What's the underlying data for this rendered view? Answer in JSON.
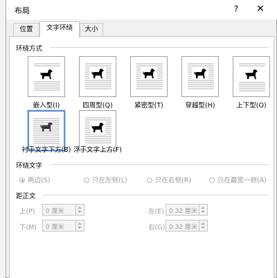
{
  "window": {
    "title": "布局",
    "help": "?",
    "close": "✕"
  },
  "tabs": [
    {
      "label": "位置",
      "active": false
    },
    {
      "label": "文字环绕",
      "active": true
    },
    {
      "label": "大小",
      "active": false
    }
  ],
  "wrap_style": {
    "heading": "环绕方式",
    "options": [
      {
        "label": "嵌入型(I)",
        "icon": "wrap-inline-icon",
        "selected": false
      },
      {
        "label": "四周型(Q)",
        "icon": "wrap-square-icon",
        "selected": false
      },
      {
        "label": "紧密型(T)",
        "icon": "wrap-tight-icon",
        "selected": false
      },
      {
        "label": "穿越型(H)",
        "icon": "wrap-through-icon",
        "selected": false
      },
      {
        "label": "上下型(O)",
        "icon": "wrap-top-bottom-icon",
        "selected": false
      },
      {
        "label": "衬于文字下方(B)",
        "icon": "wrap-behind-text-icon",
        "selected": true
      },
      {
        "label": "浮于文字上方(F)",
        "icon": "wrap-in-front-icon",
        "selected": false
      }
    ]
  },
  "wrap_text": {
    "heading": "环绕文字",
    "options": [
      {
        "label": "两边(S)",
        "checked": true
      },
      {
        "label": "只在左侧(L)",
        "checked": false
      },
      {
        "label": "只在右侧(R)",
        "checked": false
      },
      {
        "label": "只在最宽一侧(A)",
        "checked": false
      }
    ]
  },
  "distance": {
    "heading": "距正文",
    "top": {
      "label": "上(P)",
      "value": "0 厘米"
    },
    "bottom": {
      "label": "下(M)",
      "value": "0 厘米"
    },
    "left": {
      "label": "左(E)",
      "value": "0.32 厘米"
    },
    "right": {
      "label": "右(G)",
      "value": "0.32 厘米"
    }
  }
}
